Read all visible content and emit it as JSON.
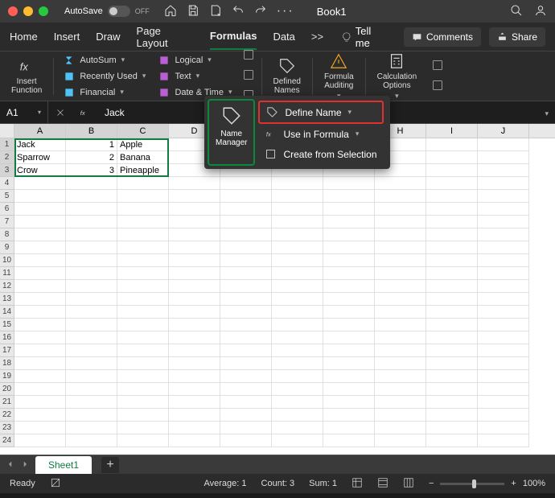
{
  "titlebar": {
    "autosave": "AutoSave",
    "autosave_state": "OFF",
    "title": "Book1"
  },
  "tabs": [
    "Home",
    "Insert",
    "Draw",
    "Page Layout",
    "Formulas",
    "Data"
  ],
  "tabs_overflow": ">>",
  "tellme": "Tell me",
  "comments": "Comments",
  "share": "Share",
  "ribbon": {
    "insert_function": "Insert\nFunction",
    "autosum": "AutoSum",
    "recent": "Recently Used",
    "financial": "Financial",
    "logical": "Logical",
    "text": "Text",
    "datetime": "Date & Time",
    "defined_names": "Defined\nNames",
    "formula_auditing": "Formula\nAuditing",
    "calc_options": "Calculation\nOptions"
  },
  "namebox": "A1",
  "formula_value": "Jack",
  "columns": [
    "A",
    "B",
    "C",
    "D",
    "E",
    "F",
    "G",
    "H",
    "I",
    "J"
  ],
  "rows_count": 24,
  "data": {
    "r1": {
      "A": "Jack",
      "B": "1",
      "C": "Apple"
    },
    "r2": {
      "A": "Sparrow",
      "B": "2",
      "C": "Banana"
    },
    "r3": {
      "A": "Crow",
      "B": "3",
      "C": "Pineapple"
    }
  },
  "popup": {
    "name_manager": "Name\nManager",
    "define_name": "Define Name",
    "use_in_formula": "Use in Formula",
    "create_from_selection": "Create from Selection"
  },
  "sheet": "Sheet1",
  "status": {
    "ready": "Ready",
    "average": "Average: 1",
    "count": "Count: 3",
    "sum": "Sum: 1",
    "zoom": "100%"
  }
}
